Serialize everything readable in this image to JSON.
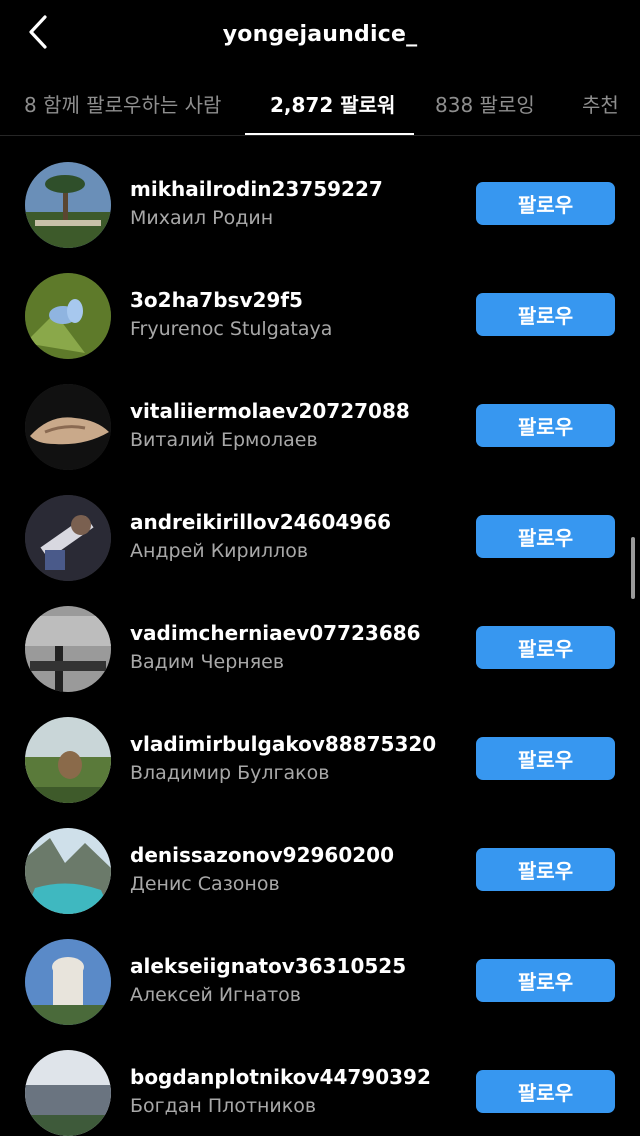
{
  "header": {
    "title": "yongejaundice_"
  },
  "tabs": [
    {
      "label": "8 함께 팔로우하는 사람"
    },
    {
      "label": "2,872 팔로워"
    },
    {
      "label": "838 팔로잉"
    },
    {
      "label": "추천"
    }
  ],
  "follow_label": "팔로우",
  "followers": [
    {
      "username": "mikhailrodin23759227",
      "name": "Михаил Родин"
    },
    {
      "username": "3o2ha7bsv29f5",
      "name": "Fryurenoc Stulgataya"
    },
    {
      "username": "vitaliiermolaev20727088",
      "name": "Виталий Ермолаев"
    },
    {
      "username": "andreikirillov24604966",
      "name": "Андрей Кириллов"
    },
    {
      "username": "vadimcherniaev07723686",
      "name": "Вадим Черняев"
    },
    {
      "username": "vladimirbulgakov88875320",
      "name": "Владимир Булгаков"
    },
    {
      "username": "denissazonov92960200",
      "name": "Денис Сазонов"
    },
    {
      "username": "alekseiignatov36310525",
      "name": "Алексей Игнатов"
    },
    {
      "username": "bogdanplotnikov44790392",
      "name": "Богдан Плотников"
    }
  ],
  "colors": {
    "background": "#000000",
    "follow_button": "#3797f0",
    "secondary_text": "#a8a8a8",
    "inactive_tab": "#8e8e8e"
  }
}
